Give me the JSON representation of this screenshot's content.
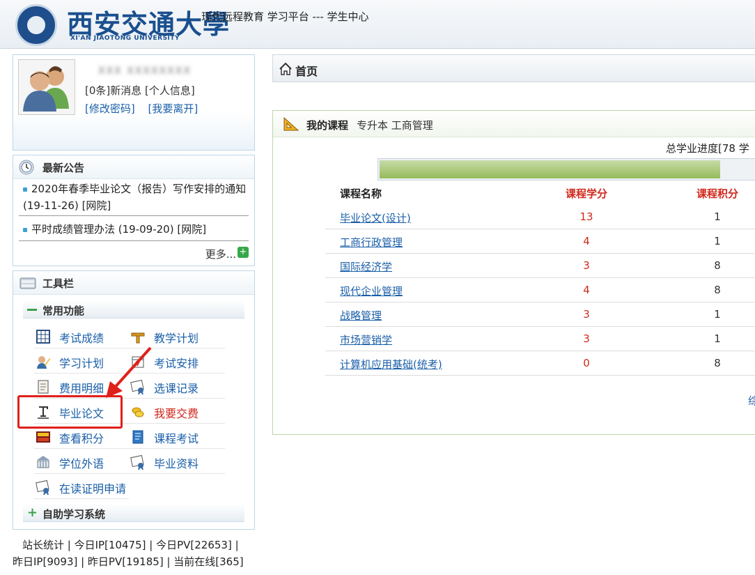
{
  "header": {
    "logo_cn": "西安交通大學",
    "logo_en": "XI'AN JIAOTONG UNIVERSITY",
    "title": "现代远程教育  学习平台 ---  学生中心"
  },
  "user": {
    "name": "XXX  XXXXXXXX",
    "messages": "[0条]新消息 [个人信息]",
    "change_password": "[修改密码]",
    "logout": "[我要离开]"
  },
  "notice": {
    "title": "最新公告",
    "items": [
      {
        "text": "2020年春季毕业论文（报告）写作安排的通知 (19-11-26)",
        "source": "[网院]"
      },
      {
        "text": "平时成绩管理办法 (19-09-20)",
        "source": "[网院]"
      }
    ],
    "more": "更多...",
    "more_icon": "+"
  },
  "tools": {
    "title": "工具栏",
    "group_common": "常用功能",
    "group_self": "自助学习系统",
    "items": [
      {
        "label": "考试成绩",
        "icon": "grid-icon"
      },
      {
        "label": "教学计划",
        "icon": "ruler-icon"
      },
      {
        "label": "学习计划",
        "icon": "pencil-user-icon"
      },
      {
        "label": "考试安排",
        "icon": "calendar-icon"
      },
      {
        "label": "费用明细",
        "icon": "scroll-icon"
      },
      {
        "label": "选课记录",
        "icon": "certificate-icon"
      },
      {
        "label": "毕业论文",
        "icon": "text-t-icon"
      },
      {
        "label": "我要交费",
        "icon": "coins-icon"
      },
      {
        "label": "查看积分",
        "icon": "score-icon"
      },
      {
        "label": "课程考试",
        "icon": "book-icon"
      },
      {
        "label": "学位外语",
        "icon": "building-icon"
      },
      {
        "label": "毕业资料",
        "icon": "certificate-icon"
      },
      {
        "label": "在读证明申请",
        "icon": "certificate-icon"
      }
    ],
    "colors": {
      "link": "#1a5fa8",
      "alert": "#d0281c",
      "highlight": "#e0201a"
    }
  },
  "stats": {
    "line1": "站长统计 | 今日IP[10475] | 今日PV[22653] |",
    "line2": "昨日IP[9093] | 昨日PV[19185] | 当前在线[365]"
  },
  "breadcrumb": {
    "home": "首页"
  },
  "courses": {
    "title": "我的课程",
    "subtitle": "专升本 工商管理",
    "progress_label": "总学业进度[78 学",
    "progress_value": 0.91,
    "headers": {
      "name": "课程名称",
      "credit": "课程学分",
      "score": "课程积分"
    },
    "rows": [
      {
        "name": "毕业论文(设计)",
        "credit": "13",
        "score": "1"
      },
      {
        "name": "工商行政管理",
        "credit": "4",
        "score": "1"
      },
      {
        "name": "国际经济学",
        "credit": "3",
        "score": "8"
      },
      {
        "name": "现代企业管理",
        "credit": "4",
        "score": "8"
      },
      {
        "name": "战略管理",
        "credit": "3",
        "score": "1"
      },
      {
        "name": "市场营销学",
        "credit": "3",
        "score": "1"
      },
      {
        "name": "计算机应用基础(统考)",
        "credit": "0",
        "score": "8"
      }
    ],
    "edge_link": "综"
  }
}
